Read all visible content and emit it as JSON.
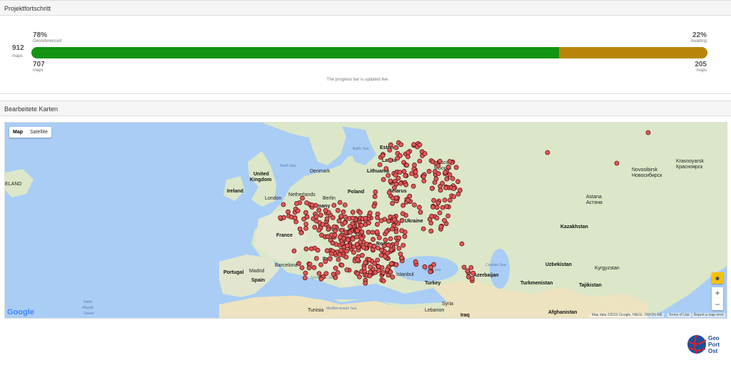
{
  "section1": {
    "title": "Projektfortschritt"
  },
  "progress": {
    "total": "912",
    "total_unit": "maps",
    "done_percent": "78%",
    "done_label": "Georeferenced",
    "await_percent": "22%",
    "await_label": "Awaiting",
    "done_count": "707",
    "done_unit": "maps",
    "await_count": "205",
    "await_unit": "maps",
    "note": "The progress bar is updated live.",
    "done_fraction": 0.78,
    "colors": {
      "done": "#139413",
      "await": "#b8860b"
    }
  },
  "section2": {
    "title": "Bearbeitete Karten"
  },
  "map": {
    "type_map": "Map",
    "type_satellite": "Satellite",
    "google": "Google",
    "attribution": "Map data ©2016 Google, INEGI, ORION-ME",
    "terms": "Terms of Use",
    "report": "Report a map error",
    "zoom_in": "+",
    "zoom_out": "−",
    "labels": {
      "north_sea": "North Sea",
      "baltic_sea": "Baltic Sea",
      "black_sea": "Black Sea",
      "caspian_sea": "Caspian Sea",
      "tyrrhenian_sea": "Tyrrhenian Sea",
      "mediterranean_sea": "Mediterranean Sea",
      "north_atlantic": "North",
      "atlantic": "Atlantic",
      "ocean": "Ocean",
      "iceland": "ELAND",
      "uk": "United",
      "kingdom": "Kingdom",
      "ireland": "Ireland",
      "london": "London",
      "denmark": "Denmark",
      "netherlands": "Netherlands",
      "germany": "Germany",
      "france": "France",
      "spain": "Spain",
      "madrid": "Madrid",
      "portugal": "Portugal",
      "barcelona": "Barcelona",
      "italy": "Italy",
      "tunisia": "Tunisia",
      "estonia": "Estonia",
      "latvia": "Latvia",
      "lithuania": "Lithuania",
      "belarus": "Belarus",
      "ukraine": "Ukraine",
      "moscow": "Moscow",
      "moscow_ru": "Москва",
      "kazakhstan": "Kazakhstan",
      "astana": "Astana",
      "astana_kz": "Астана",
      "novosibirsk": "Novosibirsk",
      "novosibirsk_ru": "Новосибирск",
      "krasnoyarsk": "Krasnoyarsk",
      "krasnoyarsk_ru": "Красноярск",
      "uzbekistan": "Uzbekistan",
      "kyrgyzstan": "Kyrgyzstan",
      "turkmenistan": "Turkmenistan",
      "tajikistan": "Tajikistan",
      "azerbaijan": "Azerbaijan",
      "turkey": "Turkey",
      "syria": "Syria",
      "lebanon": "Lebanon",
      "iraq": "Iraq",
      "afghanistan": "Afghanistan",
      "berlin": "Berlin",
      "poland": "Poland",
      "romania": "Roma",
      "austria": "Austria",
      "istanbul": "Istanbul"
    }
  }
}
